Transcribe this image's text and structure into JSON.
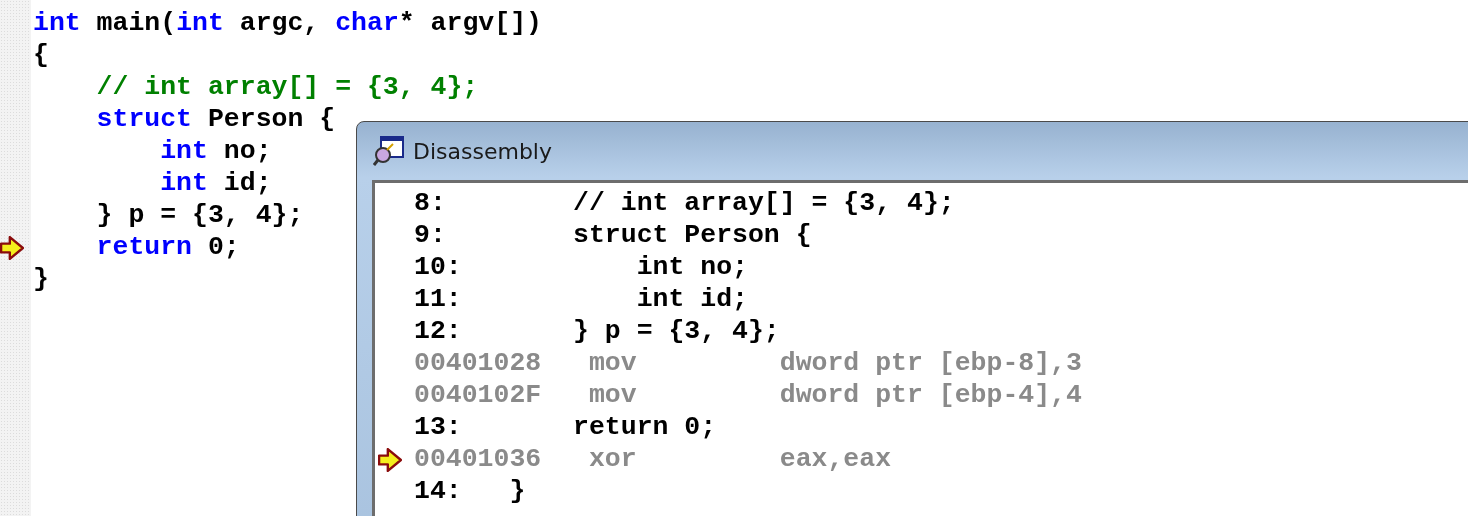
{
  "editor": {
    "lines": [
      {
        "current": false,
        "tokens": [
          {
            "kind": "keyword",
            "text": "int"
          },
          {
            "kind": "plain",
            "text": " main("
          },
          {
            "kind": "keyword",
            "text": "int"
          },
          {
            "kind": "plain",
            "text": " argc, "
          },
          {
            "kind": "keyword",
            "text": "char"
          },
          {
            "kind": "plain",
            "text": "* argv[])"
          }
        ]
      },
      {
        "current": false,
        "tokens": [
          {
            "kind": "plain",
            "text": "{"
          }
        ]
      },
      {
        "current": false,
        "tokens": [
          {
            "kind": "comment",
            "text": "    // int array[] = {3, 4};"
          }
        ]
      },
      {
        "current": false,
        "tokens": [
          {
            "kind": "keyword",
            "text": "    struct"
          },
          {
            "kind": "plain",
            "text": " Person {"
          }
        ]
      },
      {
        "current": false,
        "tokens": [
          {
            "kind": "keyword",
            "text": "        int"
          },
          {
            "kind": "plain",
            "text": " no;"
          }
        ]
      },
      {
        "current": false,
        "tokens": [
          {
            "kind": "keyword",
            "text": "        int"
          },
          {
            "kind": "plain",
            "text": " id;"
          }
        ]
      },
      {
        "current": false,
        "tokens": [
          {
            "kind": "plain",
            "text": "    } p = {3, 4};"
          }
        ]
      },
      {
        "current": true,
        "tokens": [
          {
            "kind": "keyword",
            "text": "    return"
          },
          {
            "kind": "plain",
            "text": " 0;"
          }
        ]
      },
      {
        "current": false,
        "tokens": [
          {
            "kind": "plain",
            "text": "}"
          }
        ]
      }
    ]
  },
  "disassembly": {
    "title": "Disassembly",
    "rows": [
      {
        "kind": "source",
        "number": "8:",
        "code": "      // int array[] = {3, 4};"
      },
      {
        "kind": "source",
        "number": "9:",
        "code": "      struct Person {"
      },
      {
        "kind": "source",
        "number": "10:",
        "code": "          int no;"
      },
      {
        "kind": "source",
        "number": "11:",
        "code": "          int id;"
      },
      {
        "kind": "source",
        "number": "12:",
        "code": "      } p = {3, 4};"
      },
      {
        "kind": "asm",
        "current": false,
        "address": "00401028",
        "mnemonic": "mov",
        "operands": "dword ptr [ebp-8],3"
      },
      {
        "kind": "asm",
        "current": false,
        "address": "0040102F",
        "mnemonic": "mov",
        "operands": "dword ptr [ebp-4],4"
      },
      {
        "kind": "source",
        "number": "13:",
        "code": "      return 0;"
      },
      {
        "kind": "asm",
        "current": true,
        "address": "00401036",
        "mnemonic": "xor",
        "operands": "eax,eax"
      },
      {
        "kind": "source",
        "number": "14:",
        "code": "  }"
      }
    ]
  }
}
